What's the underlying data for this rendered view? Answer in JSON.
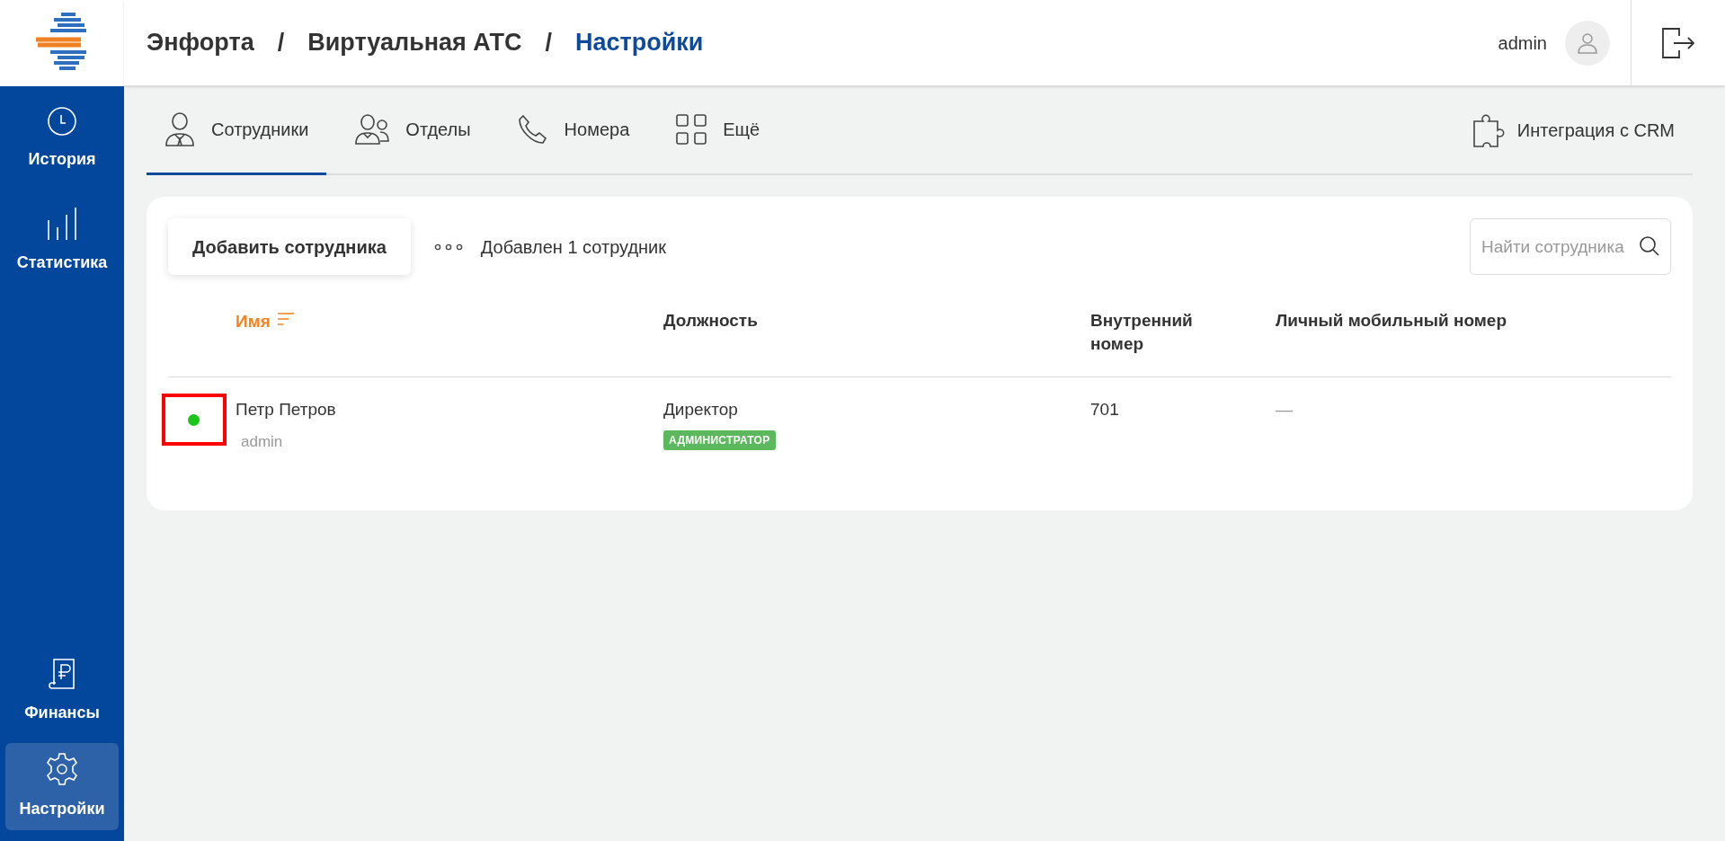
{
  "breadcrumbs": [
    {
      "label": "Энфорта",
      "selected": false
    },
    {
      "label": "Виртуальная АТС",
      "selected": false
    },
    {
      "label": "Настройки",
      "selected": true
    }
  ],
  "separator": "/",
  "user": {
    "name": "admin"
  },
  "sidebar": {
    "top_items": [
      {
        "label": "История",
        "selected": false
      },
      {
        "label": "Статистика",
        "selected": false
      }
    ],
    "bottom_items": [
      {
        "label": "Финансы",
        "selected": false
      },
      {
        "label": "Настройки",
        "selected": true
      }
    ]
  },
  "tabs": [
    {
      "label": "Сотрудники",
      "selected": true
    },
    {
      "label": "Отделы",
      "selected": false
    },
    {
      "label": "Номера",
      "selected": false
    },
    {
      "label": "Ещё",
      "selected": false
    }
  ],
  "crm_link": {
    "label": "Интеграция с CRM"
  },
  "toolbar": {
    "add_button": "Добавить сотрудника",
    "status": "Добавлен 1 сотрудник",
    "search": {
      "placeholder": "Найти сотрудника"
    }
  },
  "table": {
    "columns": [
      {
        "label": "Имя",
        "sorted": true
      },
      {
        "label": "Должность",
        "sorted": false
      },
      {
        "label": "Внутренний номер",
        "sorted": false
      },
      {
        "label": "Личный мобильный номер",
        "sorted": false
      }
    ],
    "rows": [
      {
        "color": "#19c619",
        "highlighted": true,
        "name": "Петр Петров",
        "login": "admin",
        "position": "Директор",
        "role": "АДМИНИСТРАТОР",
        "extension": "701",
        "mobile": "—"
      }
    ]
  }
}
